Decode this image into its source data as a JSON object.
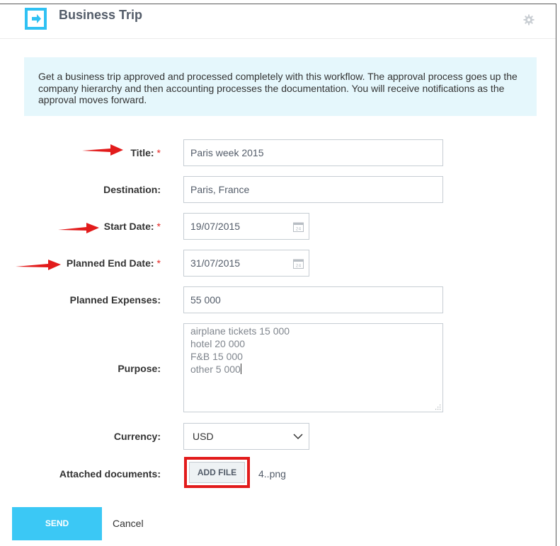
{
  "header": {
    "title": "Business Trip",
    "app_icon": "arrow-right-box-icon",
    "settings_icon": "gear-icon"
  },
  "info": {
    "text": "Get a business trip approved and processed completely with this workflow. The approval process goes up the company hierarchy and then accounting processes the documentation. You will receive notifications as the approval moves forward."
  },
  "fields": {
    "title": {
      "label": "Title:",
      "value": "Paris week 2015",
      "required": "*"
    },
    "destination": {
      "label": "Destination:",
      "value": "Paris, France"
    },
    "start_date": {
      "label": "Start Date:",
      "value": "19/07/2015",
      "required": "*"
    },
    "end_date": {
      "label": "Planned End Date:",
      "value": "31/07/2015",
      "required": "*"
    },
    "expenses": {
      "label": "Planned Expenses:",
      "value": "55 000"
    },
    "purpose": {
      "label": "Purpose:",
      "lines": [
        "airplane tickets 15 000",
        "hotel 20 000",
        "F&B 15 000",
        "other 5 000"
      ]
    },
    "currency": {
      "label": "Currency:",
      "value": "USD"
    },
    "attachments": {
      "label": "Attached documents:",
      "button": "ADD FILE",
      "file_name": "4..png"
    }
  },
  "calendar_icon_text": "24",
  "actions": {
    "send": "SEND",
    "cancel": "Cancel"
  },
  "colors": {
    "accent": "#3bc8f5",
    "info_bg": "#e5f7fc",
    "required": "#e52522",
    "annotation": "#e21b1b"
  }
}
